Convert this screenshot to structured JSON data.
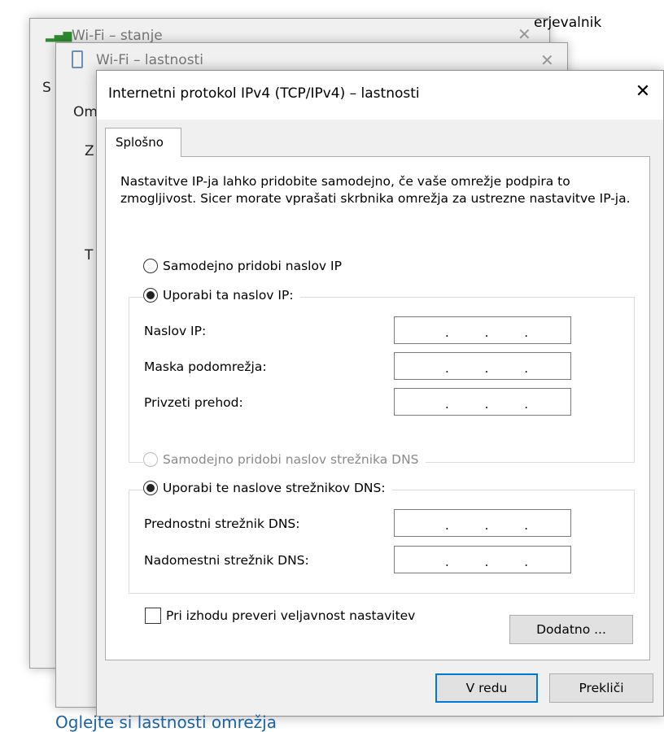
{
  "background": {
    "top_text_fragment": "erjevalnik",
    "wifi_status_title": "Wi-Fi – stanje",
    "wifi_props_title": "Wi-Fi – lastnosti",
    "props_tab_fragment": "Om",
    "side_letters": [
      "S",
      "Z",
      "T"
    ],
    "bottom_link": "Oglejte si lastnosti omrežja"
  },
  "dialog": {
    "title": "Internetni protokol IPv4 (TCP/IPv4) – lastnosti",
    "close_glyph": "✕",
    "tab_label": "Splošno",
    "description": "Nastavitve IP-ja lahko pridobite samodejno, če vaše omrežje podpira to zmogljivost. Sicer morate vprašati skrbnika omrežja za ustrezne nastavitve IP-ja.",
    "ip_auto_label": "Samodejno pridobi naslov IP",
    "ip_manual_label": "Uporabi ta naslov IP:",
    "ip_fields": [
      {
        "label": "Naslov IP:",
        "value": "   .   .   ."
      },
      {
        "label": "Maska podomrežja:",
        "value": "   .   .   ."
      },
      {
        "label": "Privzeti prehod:",
        "value": "   .   .   ."
      }
    ],
    "dns_auto_label": "Samodejno pridobi naslov strežnika DNS",
    "dns_manual_label": "Uporabi te naslove strežnikov DNS:",
    "dns_fields": [
      {
        "label": "Prednostni strežnik DNS:",
        "value": "   .   .   ."
      },
      {
        "label": "Nadomestni strežnik DNS:",
        "value": "   .   .   ."
      }
    ],
    "validate_label": "Pri izhodu preveri veljavnost nastavitev",
    "advanced_button": "Dodatno ...",
    "ok_button": "V redu",
    "cancel_button": "Prekliči",
    "ip_dot": "."
  }
}
